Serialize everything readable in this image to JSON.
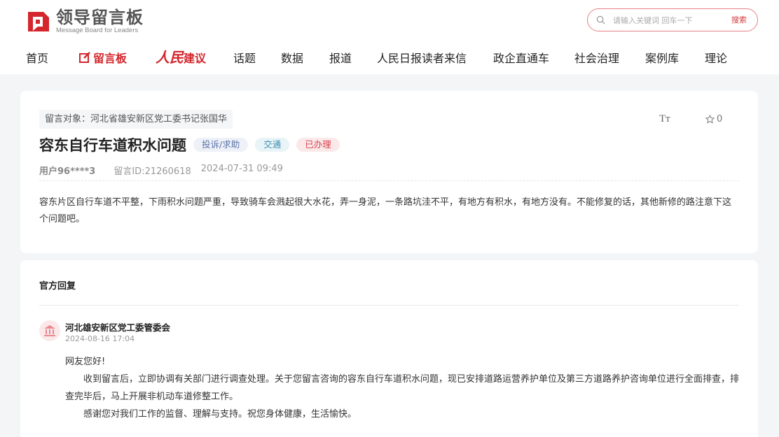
{
  "logo": {
    "title": "领导留言板",
    "subtitle": "Message Board for Leaders",
    "icon": "logo-mark-icon",
    "brand_color": "#d4262c"
  },
  "search": {
    "placeholder": "请输入关键词 回车一下",
    "button_label": "搜索"
  },
  "nav": {
    "home": "首页",
    "board": "留言板",
    "brand_big": "人民",
    "brand_small": "建议",
    "items": [
      "话题",
      "数据",
      "报道",
      "人民日报读者来信",
      "政企直通车",
      "社会治理",
      "案例库",
      "理论"
    ]
  },
  "message": {
    "target": "留言对象：河北省雄安新区党工委书记张国华",
    "font_toggle": "Tт",
    "favorite_count": "0",
    "title": "容东自行车道积水问题",
    "tags": [
      "投诉/求助",
      "交通",
      "已办理"
    ],
    "user": "用户96****3",
    "message_id": "留言ID:21260618",
    "date": "2024-07-31 09:49",
    "content": "容东片区自行车道不平整，下雨积水问题严重，导致骑车会溅起很大水花，弄一身泥，一条路坑洼不平，有地方有积水，有地方没有。不能修复的话，其他新修的路注意下这个问题吧。"
  },
  "reply": {
    "section_title": "官方回复",
    "org": "河北雄安新区党工委管委会",
    "date": "2024-08-16 17:04",
    "greeting": "网友您好!",
    "body": "收到留言后，立即协调有关部门进行调查处理。关于您留言咨询的容东自行车道积水问题，现已安排道路运营养护单位及第三方道路养护咨询单位进行全面排查，排查完毕后，马上开展非机动车道修整工作。",
    "closing": "感谢您对我们工作的监督、理解与支持。祝您身体健康，生活愉快。"
  }
}
